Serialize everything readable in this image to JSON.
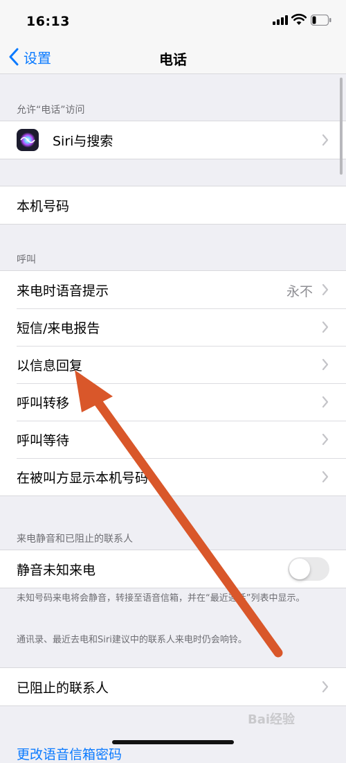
{
  "status": {
    "time": "16:13"
  },
  "nav": {
    "back_label": "设置",
    "title": "电话"
  },
  "sections": {
    "allow_access": {
      "header": "允许“电话”访问",
      "siri_label": "Siri与搜索"
    },
    "my_number": {
      "label": "本机号码"
    },
    "calls": {
      "header": "呼叫",
      "rows": [
        {
          "label": "来电时语音提示",
          "detail": "永不"
        },
        {
          "label": "短信/来电报告"
        },
        {
          "label": "以信息回复"
        },
        {
          "label": "呼叫转移"
        },
        {
          "label": "呼叫等待"
        },
        {
          "label": "在被叫方显示本机号码"
        }
      ]
    },
    "silence": {
      "header": "来电静音和已阻止的联系人",
      "toggle_label": "静音未知来电",
      "toggle_on": false,
      "note1": "未知号码来电将会静音，转接至语音信箱，并在“最近通话”列表中显示。",
      "note2": "通讯录、最近去电和Siri建议中的联系人来电时仍会响铃。"
    },
    "blocked": {
      "label": "已阻止的联系人"
    },
    "partial_link": "更改语音信箱密码"
  },
  "watermark": "Bai经验",
  "colors": {
    "accent": "#0a7aff",
    "arrow": "#d9572a",
    "background": "#efeff4"
  },
  "icons": [
    "chevron-left-icon",
    "siri-icon",
    "chevron-right-icon",
    "signal-icon",
    "wifi-icon",
    "battery-icon"
  ]
}
